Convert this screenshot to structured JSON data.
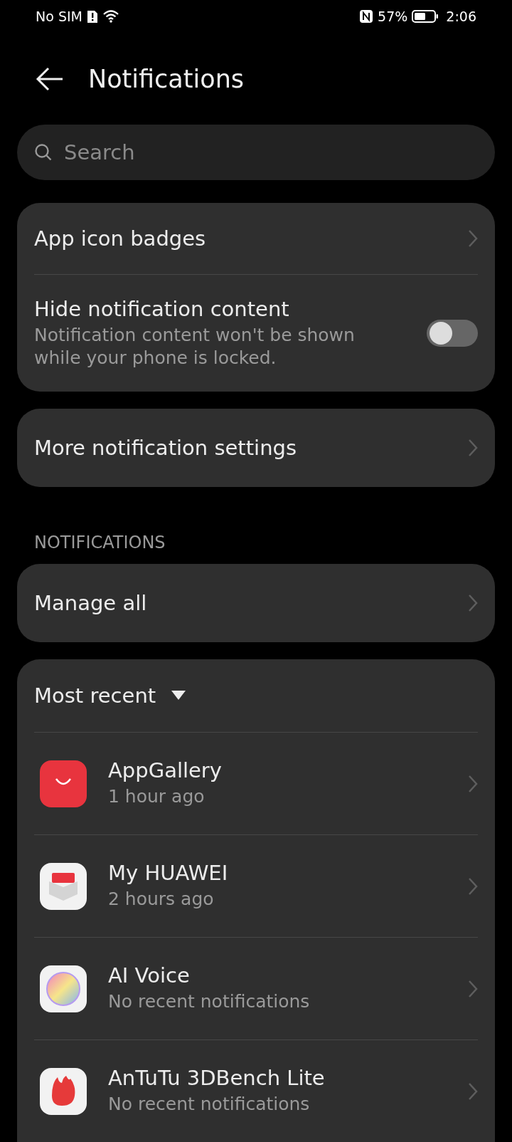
{
  "status_bar": {
    "carrier": "No SIM",
    "battery": "57%",
    "time": "2:06"
  },
  "header": {
    "title": "Notifications"
  },
  "search": {
    "placeholder": "Search"
  },
  "settings": [
    {
      "kind": "link",
      "label": "App icon badges"
    },
    {
      "kind": "toggle",
      "label": "Hide notification content",
      "description": "Notification content won't be shown while your phone is locked.",
      "on": false
    }
  ],
  "more_settings": {
    "label": "More notification settings"
  },
  "section_title": "NOTIFICATIONS",
  "manage_all": {
    "label": "Manage all"
  },
  "recent": {
    "sort": "Most recent",
    "apps": [
      {
        "kind": "appgallery",
        "name": "AppGallery",
        "time": "1 hour ago"
      },
      {
        "kind": "myhuawei",
        "name": "My HUAWEI",
        "time": "2 hours ago"
      },
      {
        "kind": "aivoice",
        "name": "AI Voice",
        "time": "No recent notifications"
      },
      {
        "kind": "antutu",
        "name": "AnTuTu 3DBench Lite",
        "time": "No recent notifications"
      }
    ]
  }
}
